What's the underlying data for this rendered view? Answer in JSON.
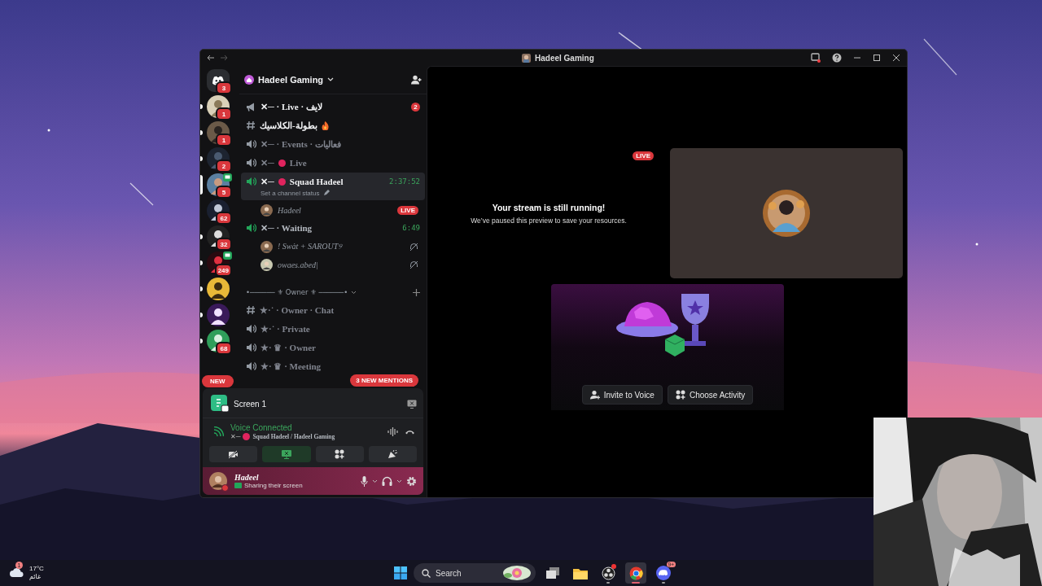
{
  "window": {
    "title": "Hadeel Gaming"
  },
  "servers": [
    {
      "kind": "home",
      "badge": "3",
      "selected": false,
      "unread": false,
      "streaming": false
    },
    {
      "kind": "picture",
      "badge": "1",
      "selected": false,
      "unread": true,
      "streaming": false
    },
    {
      "kind": "picture",
      "badge": "1",
      "selected": false,
      "unread": true,
      "streaming": false
    },
    {
      "kind": "picture",
      "badge": "2",
      "selected": false,
      "unread": true,
      "streaming": false
    },
    {
      "kind": "picture",
      "badge": "5",
      "selected": true,
      "unread": false,
      "streaming": true
    },
    {
      "kind": "picture",
      "badge": "62",
      "selected": false,
      "unread": false,
      "streaming": false
    },
    {
      "kind": "picture",
      "badge": "32",
      "selected": false,
      "unread": true,
      "streaming": false
    },
    {
      "kind": "picture",
      "badge": "249",
      "selected": false,
      "unread": true,
      "streaming": true
    },
    {
      "kind": "picture",
      "selected": false,
      "unread": true,
      "streaming": false
    },
    {
      "kind": "picture",
      "selected": false,
      "unread": true,
      "streaming": false
    },
    {
      "kind": "picture",
      "badge": "68",
      "selected": false,
      "unread": true,
      "streaming": false
    }
  ],
  "new_pill": "NEW",
  "server_header": {
    "name": "Hadeel Gaming"
  },
  "channels": [
    {
      "kind": "announcement",
      "name": "✕─ · Live · لايف",
      "badge": "2",
      "unread": true,
      "selected": false
    },
    {
      "kind": "text",
      "name": "بطولة-الكلاسيك",
      "flame": true,
      "unread": true,
      "selected": false
    },
    {
      "kind": "voice",
      "name": "✕─ · Events · فعاليات",
      "unread": false,
      "selected": false,
      "active": false
    },
    {
      "kind": "voice",
      "name": "✕─",
      "live_dot": true,
      "name_after": "Live",
      "unread": false,
      "selected": false,
      "active": false
    },
    {
      "kind": "voice",
      "name": "✕─",
      "live_dot": true,
      "name_after": "Squad Hadeel",
      "unread": true,
      "selected": true,
      "active": true,
      "timer": "2:37:52",
      "status": "Set a channel status",
      "members": [
        {
          "name": "Hadeel",
          "live": "LIVE",
          "deafened": false
        }
      ]
    },
    {
      "kind": "voice",
      "name": "✕─ · Waiting",
      "unread": false,
      "selected": false,
      "active": true,
      "timer": "6:49",
      "members": [
        {
          "name": "! Swȧt + SAROUT୨",
          "deafened": true
        },
        {
          "name": "owaes.abed|",
          "deafened": true
        }
      ]
    }
  ],
  "category": {
    "name": "•────── ⚜ Owner ⚜ ──────•",
    "channels": [
      {
        "kind": "text",
        "name": "★·˙ · Owner · Chat",
        "unread": false,
        "selected": false
      },
      {
        "kind": "voice",
        "name": "★·˙ · Private",
        "unread": false,
        "selected": false,
        "active": false
      },
      {
        "kind": "voice",
        "name": "★· ♛ · Owner",
        "unread": false,
        "selected": false,
        "active": false
      },
      {
        "kind": "voice",
        "name": "★· ♛ · Meeting",
        "unread": false,
        "selected": false,
        "active": false
      }
    ]
  },
  "mentions_pill": "3 NEW MENTIONS",
  "stream_panel": {
    "title": "Screen 1"
  },
  "voice_panel": {
    "status": "Voice Connected",
    "location": "Squad Hadeel / Hadeel Gaming",
    "location_prefix": "✕─",
    "location_dot": true,
    "buttons": [
      {
        "kind": "camera-off",
        "active": false
      },
      {
        "kind": "screen",
        "active": true
      },
      {
        "kind": "activity",
        "active": false
      },
      {
        "kind": "soundboard",
        "active": false
      }
    ]
  },
  "user_panel": {
    "name": "Hadeel",
    "status": "Sharing their screen"
  },
  "stream": {
    "badge": "LIVE",
    "title": "Your stream is still running!",
    "message": "We’ve paused this preview to save your resources."
  },
  "activity": {
    "buttons": [
      {
        "kind": "invite",
        "label": "Invite to Voice"
      },
      {
        "kind": "activity",
        "label": "Choose Activity"
      }
    ]
  },
  "taskbar": {
    "weather": {
      "temp": "17°C",
      "condition": "غائم",
      "badge": "1"
    },
    "search": {
      "placeholder": "Search"
    },
    "apps": [
      {
        "kind": "taskview",
        "selected": false,
        "running": false
      },
      {
        "kind": "folder",
        "selected": false,
        "running": false
      },
      {
        "kind": "obs",
        "selected": false,
        "running": true,
        "alert": true
      },
      {
        "kind": "chrome",
        "selected": true,
        "running": true
      },
      {
        "kind": "discord",
        "selected": false,
        "running": true,
        "badge": "9+"
      }
    ]
  }
}
